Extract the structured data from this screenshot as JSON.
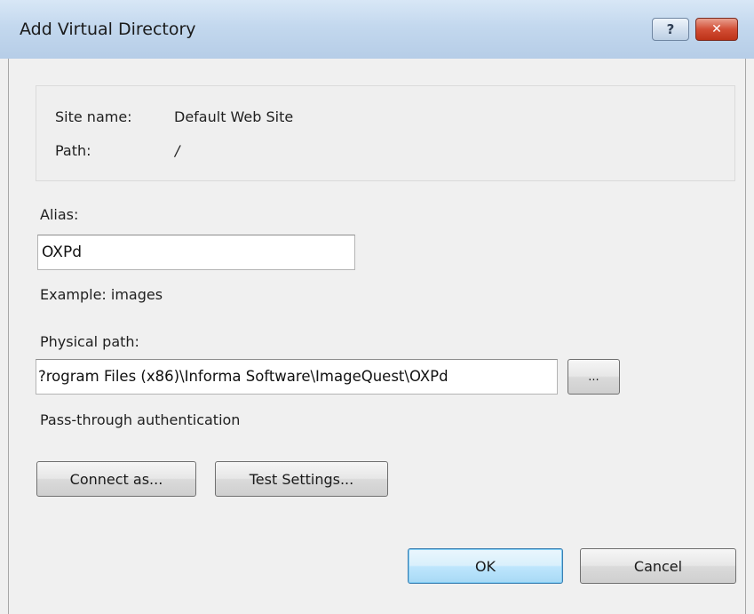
{
  "window": {
    "title": "Add Virtual Directory",
    "help_glyph": "?",
    "close_glyph": "✕"
  },
  "info": {
    "site_name_label": "Site name:",
    "site_name_value": "Default Web Site",
    "path_label": "Path:",
    "path_value": "/"
  },
  "alias": {
    "label": "Alias:",
    "value": "OXPd",
    "example": "Example: images"
  },
  "physical_path": {
    "label": "Physical path:",
    "value": "?rogram Files (x86)\\Informa Software\\ImageQuest\\OXPd",
    "browse_label": "..."
  },
  "auth": {
    "label": "Pass-through authentication"
  },
  "buttons": {
    "connect_as": "Connect as...",
    "test_settings": "Test Settings...",
    "ok": "OK",
    "cancel": "Cancel"
  }
}
